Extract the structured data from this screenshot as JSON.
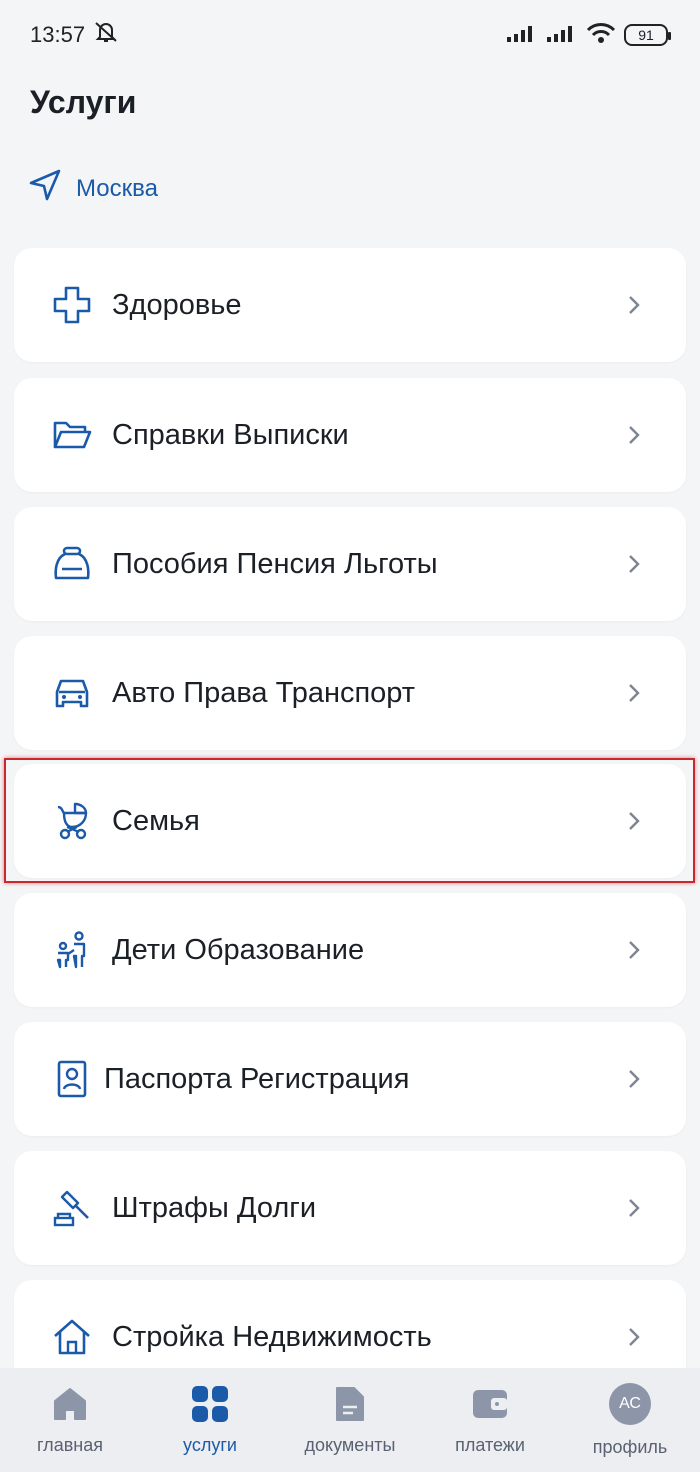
{
  "status": {
    "time": "13:57",
    "battery": "91"
  },
  "header": {
    "title": "Услуги"
  },
  "location": {
    "city": "Москва"
  },
  "services": [
    {
      "label": "Здоровье",
      "icon": "health-cross-icon"
    },
    {
      "label": "Справки Выписки",
      "icon": "folder-icon"
    },
    {
      "label": "Пособия Пенсия Льготы",
      "icon": "purse-icon"
    },
    {
      "label": "Авто Права Транспорт",
      "icon": "car-icon"
    },
    {
      "label": "Семья",
      "icon": "stroller-icon"
    },
    {
      "label": "Дети Образование",
      "icon": "children-icon"
    },
    {
      "label": "Паспорта Регистрация",
      "icon": "passport-icon"
    },
    {
      "label": "Штрафы Долги",
      "icon": "gavel-icon"
    },
    {
      "label": "Стройка Недвижимость",
      "icon": "house-icon"
    }
  ],
  "nav": {
    "home": "главная",
    "services": "услуги",
    "documents": "документы",
    "payments": "платежи",
    "profile": "профиль",
    "avatar_initials": "АС"
  },
  "colors": {
    "accent": "#1b5aa8",
    "highlight": "#c8282e",
    "background": "#f4f5f7"
  }
}
